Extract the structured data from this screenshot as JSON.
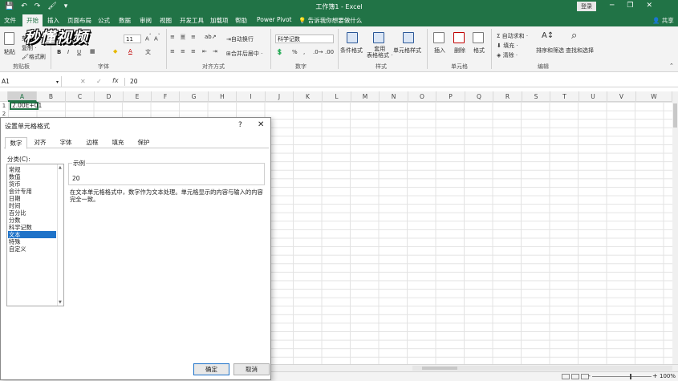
{
  "title": {
    "window_title": "工作簿1 - Excel",
    "login": "登录",
    "qa": [
      "💾",
      "↶",
      "↷",
      "🖌",
      "▾"
    ],
    "minimize": "─",
    "restore": "❐",
    "close": "✕"
  },
  "menu": {
    "tabs": [
      "文件",
      "开始",
      "插入",
      "页面布局",
      "公式",
      "数据",
      "审阅",
      "视图",
      "开发工具",
      "加载项",
      "帮助",
      "Power Pivot"
    ],
    "active": "开始",
    "tell_me": "告诉我你想要做什么",
    "share": "共享"
  },
  "watermark": "秒懂视频",
  "ribbon": {
    "paste": "粘贴",
    "cut": "剪切",
    "copy": "复制 ·",
    "format_painter": "格式刷",
    "font_size": "11",
    "bold": "B",
    "italic": "I",
    "underline": "U",
    "wrap_text": "自动换行",
    "merge_center": "合并后居中 ·",
    "number_format": "科学记数",
    "percent": "%",
    "comma": ",",
    "conditional_format": "条件格式",
    "format_as_table": "套用\n表格格式 ·",
    "cell_styles": "单元格样式",
    "insert": "插入",
    "delete": "删除",
    "format": "格式",
    "autosum": "自动求和 ·",
    "fill": "填充 ·",
    "clear": "清除 ·",
    "sort_filter": "排序和筛选",
    "find_select": "查找和选择",
    "groups": {
      "clipboard": "剪贴板",
      "font": "字体",
      "alignment": "对齐方式",
      "number": "数字",
      "styles": "样式",
      "cells": "单元格",
      "editing": "编辑"
    }
  },
  "formula_bar": {
    "name_box": "A1",
    "fx": "fx",
    "value": "20"
  },
  "sheet": {
    "columns": [
      "A",
      "B",
      "C",
      "D",
      "E",
      "F",
      "G",
      "H",
      "I",
      "J",
      "K",
      "L",
      "M",
      "N",
      "O",
      "P",
      "Q",
      "R",
      "S",
      "T",
      "U",
      "V",
      "W"
    ],
    "rows": [
      "1",
      "2"
    ],
    "a1_value": "2.00E+01"
  },
  "status": {
    "zoom": "100%",
    "minus": "-",
    "plus": "+"
  },
  "dialog": {
    "title": "设置单元格格式",
    "help": "?",
    "close": "✕",
    "tabs": [
      "数字",
      "对齐",
      "字体",
      "边框",
      "填充",
      "保护"
    ],
    "active_tab": "数字",
    "category_label": "分类(C):",
    "categories": [
      "常规",
      "数值",
      "货币",
      "会计专用",
      "日期",
      "时间",
      "百分比",
      "分数",
      "科学记数",
      "文本",
      "特殊",
      "自定义"
    ],
    "selected_category": "文本",
    "sample_label": "示例",
    "sample_value": "20",
    "description": "在文本单元格格式中，数字作为文本处理。单元格显示的内容与输入的内容完全一致。",
    "ok": "确定",
    "cancel": "取消"
  }
}
